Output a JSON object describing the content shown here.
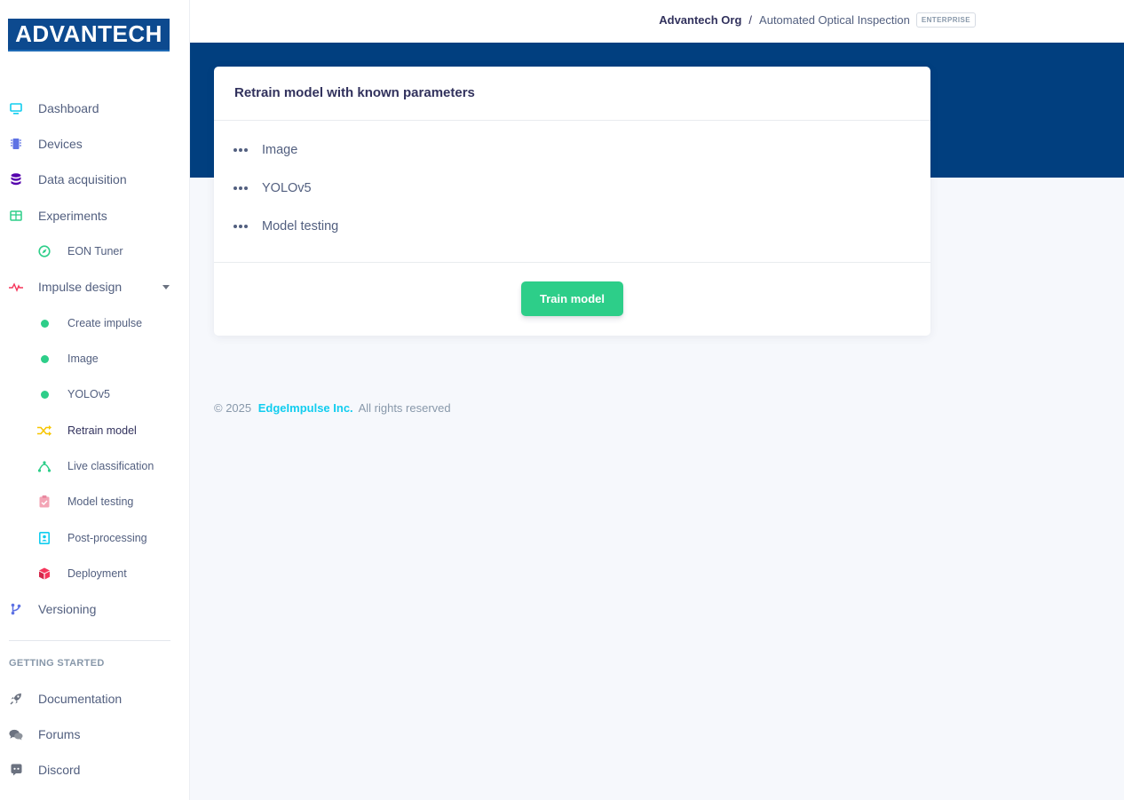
{
  "brand": {
    "logo_text": "ADVANTECH"
  },
  "header": {
    "org": "Advantech Org",
    "separator": "/",
    "project": "Automated Optical Inspection",
    "badge": "ENTERPRISE"
  },
  "sidebar": {
    "items": [
      {
        "label": "Dashboard",
        "icon": "monitor-icon"
      },
      {
        "label": "Devices",
        "icon": "chip-icon"
      },
      {
        "label": "Data acquisition",
        "icon": "database-icon"
      },
      {
        "label": "Experiments",
        "icon": "table-icon"
      },
      {
        "label": "EON Tuner",
        "icon": "compass-icon"
      },
      {
        "label": "Impulse design",
        "icon": "pulse-icon"
      },
      {
        "label": "Create impulse",
        "icon": "dot-icon"
      },
      {
        "label": "Image",
        "icon": "dot-icon"
      },
      {
        "label": "YOLOv5",
        "icon": "dot-icon"
      },
      {
        "label": "Retrain model",
        "icon": "shuffle-icon"
      },
      {
        "label": "Live classification",
        "icon": "radar-icon"
      },
      {
        "label": "Model testing",
        "icon": "clipboard-check-icon"
      },
      {
        "label": "Post-processing",
        "icon": "contact-icon"
      },
      {
        "label": "Deployment",
        "icon": "cube-icon"
      },
      {
        "label": "Versioning",
        "icon": "branch-icon"
      }
    ],
    "section_title": "GETTING STARTED",
    "help_items": [
      {
        "label": "Documentation",
        "icon": "rocket-icon"
      },
      {
        "label": "Forums",
        "icon": "chat-icon"
      },
      {
        "label": "Discord",
        "icon": "discord-icon"
      }
    ]
  },
  "card": {
    "title": "Retrain model with known parameters",
    "steps": [
      "Image",
      "YOLOv5",
      "Model testing"
    ],
    "button": "Train model"
  },
  "footer": {
    "copyright": "© 2025",
    "company": "EdgeImpulse Inc.",
    "rights": "All rights reserved"
  },
  "colors": {
    "banner": "#013f7f",
    "accent_green": "#2dce89",
    "link_cyan": "#11cdef"
  }
}
